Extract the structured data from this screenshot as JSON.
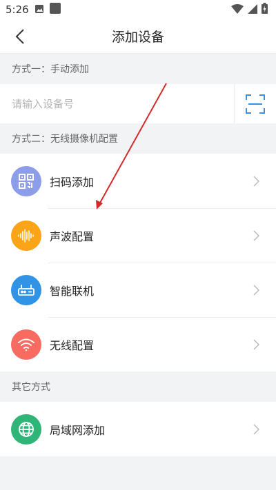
{
  "status_bar": {
    "time": "5:26",
    "icons": [
      "image-icon",
      "app-square-icon",
      "wifi-icon",
      "cellular-icon",
      "battery-icon"
    ]
  },
  "app_bar": {
    "title": "添加设备",
    "back_icon": "chevron-left-icon"
  },
  "section_manual": {
    "header": "方式一：手动添加",
    "input_placeholder": "请输入设备号",
    "input_value": "",
    "scan_icon": "scan-frame-icon"
  },
  "section_wireless": {
    "header": "方式二：无线摄像机配置",
    "items": [
      {
        "label": "扫码添加",
        "icon": "qr-code-icon",
        "color": "#8c9eea"
      },
      {
        "label": "声波配置",
        "icon": "sound-wave-icon",
        "color": "#fba418"
      },
      {
        "label": "智能联机",
        "icon": "router-icon",
        "color": "#3093e6"
      },
      {
        "label": "无线配置",
        "icon": "wifi-icon",
        "color": "#f76b61"
      }
    ]
  },
  "section_other": {
    "header": "其它方式",
    "items": [
      {
        "label": "局域网添加",
        "icon": "globe-icon",
        "color": "#2eb577"
      }
    ]
  },
  "colors": {
    "background": "#f2f3f5",
    "annotation_arrow": "#d42a2a",
    "scan_accent": "#3d8fe0"
  }
}
